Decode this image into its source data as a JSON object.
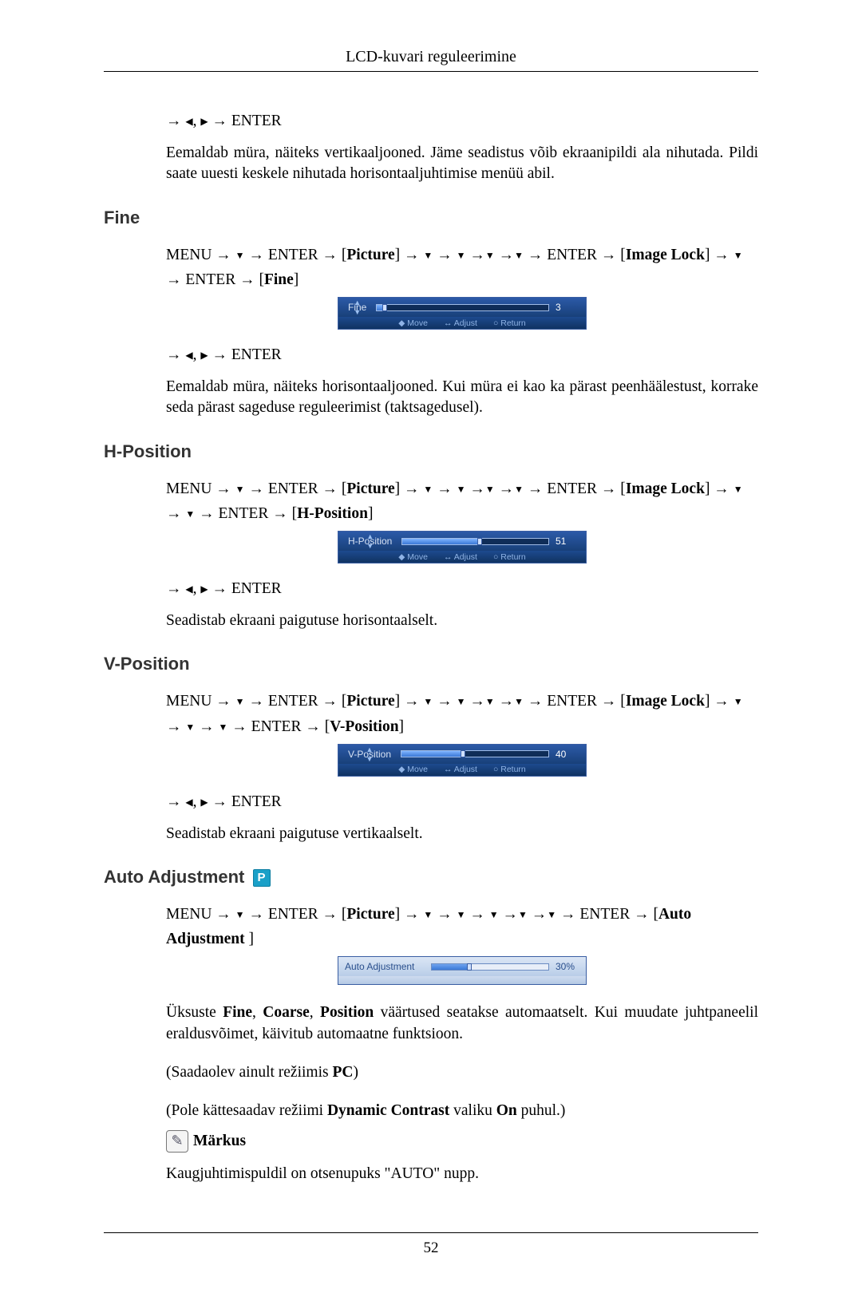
{
  "header": "LCD-kuvari reguleerimine",
  "page_number": "52",
  "intro": {
    "enter_suffix": "ENTER",
    "body": "Eemaldab müra, näiteks vertikaaljooned. Jäme seadistus võib ekraanipildi ala nihutada. Pildi saate uuesti keskele nihutada horisontaaljuhtimise menüü abil."
  },
  "arrows": {
    "right": "→",
    "down": "▼",
    "left": "◀",
    "play": "▶",
    "up": "▲",
    "dot": "◆",
    "ring": "○",
    "lr": "↔"
  },
  "sections": {
    "fine": {
      "title": "Fine",
      "path_parts": [
        "MENU →",
        "→ ENTER → [",
        "Picture",
        "] →",
        "→",
        "→",
        "→",
        "→ ENTER → [",
        "Image Lock",
        "] →",
        "→ ENTER → [",
        "Fine",
        "]"
      ],
      "osd": {
        "label": "Fine",
        "value": "3",
        "pct": 3,
        "btn_move": "Move",
        "btn_adj": "Adjust",
        "btn_ret": "Return"
      },
      "enter_suffix": "ENTER",
      "body": "Eemaldab müra, näiteks horisontaaljooned. Kui müra ei kao ka pärast peenhäälestust, korrake seda pärast sageduse reguleerimist (taktsagedusel)."
    },
    "hpos": {
      "title": "H-Position",
      "path_parts": [
        "MENU →",
        "→ ENTER → [",
        "Picture",
        "] →",
        "→",
        "→",
        "→",
        "→ ENTER → [",
        "Image Lock",
        "] →",
        "→",
        "→ ENTER → [",
        "H-Position",
        "]"
      ],
      "osd": {
        "label": "H-Position",
        "value": "51",
        "pct": 51,
        "btn_move": "Move",
        "btn_adj": "Adjust",
        "btn_ret": "Return"
      },
      "enter_suffix": "ENTER",
      "body": "Seadistab ekraani paigutuse horisontaalselt."
    },
    "vpos": {
      "title": "V-Position",
      "path_parts": [
        "MENU →",
        "→ ENTER → [",
        "Picture",
        "] →",
        "→",
        "→",
        "→",
        "→ ENTER → [",
        "Image Lock",
        "] →",
        "→",
        "→",
        "→ ENTER → [",
        "V-Position",
        "]"
      ],
      "osd": {
        "label": "V-Position",
        "value": "40",
        "pct": 40,
        "btn_move": "Move",
        "btn_adj": "Adjust",
        "btn_ret": "Return"
      },
      "enter_suffix": "ENTER",
      "body": "Seadistab ekraani paigutuse vertikaalselt."
    },
    "auto": {
      "title": "Auto Adjustment",
      "badge": "P",
      "path_parts": [
        "MENU →",
        "→ ENTER → [",
        "Picture",
        "] →",
        "→",
        "→",
        "→",
        "→",
        "→ ENTER → [",
        "Auto Adjustment",
        " ]"
      ],
      "osd": {
        "label": "Auto Adjustment",
        "value": "30%",
        "pct": 30
      },
      "body1_a": "Üksuste ",
      "body1_b": "Fine",
      "body1_c": ", ",
      "body1_d": "Coarse",
      "body1_e": ", ",
      "body1_f": "Position",
      "body1_g": " väärtused seatakse automaatselt. Kui muudate juhtpaneelil eraldus­võimet, käivitub automaatne funktsioon.",
      "body2_a": "(Saadaolev ainult režiimis ",
      "body2_b": "PC",
      "body2_c": ")",
      "body3_a": "(Pole kättesaadav režiimi ",
      "body3_b": "Dynamic Contrast",
      "body3_c": " valiku ",
      "body3_d": "On",
      "body3_e": " puhul.)",
      "note_label": "Märkus",
      "body4": "Kaugjuhtimispuldil on otsenupuks \"AUTO\" nupp."
    }
  }
}
